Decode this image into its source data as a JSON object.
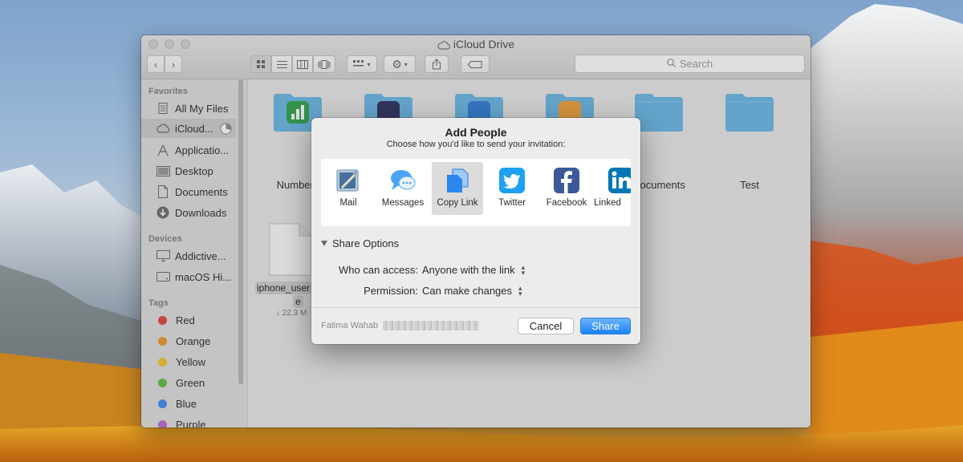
{
  "window": {
    "title": "iCloud Drive",
    "search_placeholder": "Search"
  },
  "sidebar": {
    "favorites_header": "Favorites",
    "favorites": [
      {
        "label": "All My Files",
        "icon": "all-files-icon"
      },
      {
        "label": "iCloud...",
        "icon": "cloud-icon",
        "selected": true
      },
      {
        "label": "Applicatio...",
        "icon": "applications-icon"
      },
      {
        "label": "Desktop",
        "icon": "desktop-icon"
      },
      {
        "label": "Documents",
        "icon": "documents-icon"
      },
      {
        "label": "Downloads",
        "icon": "downloads-icon"
      }
    ],
    "devices_header": "Devices",
    "devices": [
      {
        "label": "Addictive...",
        "icon": "monitor-icon"
      },
      {
        "label": "macOS Hi...",
        "icon": "disk-icon"
      }
    ],
    "tags_header": "Tags",
    "tags": [
      {
        "label": "Red",
        "color": "#e0443e"
      },
      {
        "label": "Orange",
        "color": "#f0952a"
      },
      {
        "label": "Yellow",
        "color": "#efc627"
      },
      {
        "label": "Green",
        "color": "#5fc040"
      },
      {
        "label": "Blue",
        "color": "#3f8ef2"
      },
      {
        "label": "Purple",
        "color": "#b56ad8"
      }
    ]
  },
  "content": {
    "folders": [
      {
        "label": "Numbers"
      },
      {
        "label": "Documents"
      },
      {
        "label": "Test"
      }
    ],
    "file": {
      "name_line1": "iphone_user",
      "name_line2": "e",
      "size": "↓ 22.3 M"
    }
  },
  "sheet": {
    "title": "Add People",
    "subtitle": "Choose how you'd like to send your invitation:",
    "services": [
      {
        "label": "Mail",
        "icon": "mail-icon"
      },
      {
        "label": "Messages",
        "icon": "messages-icon"
      },
      {
        "label": "Copy Link",
        "icon": "copy-link-icon",
        "selected": true
      },
      {
        "label": "Twitter",
        "icon": "twitter-icon"
      },
      {
        "label": "Facebook",
        "icon": "facebook-icon"
      },
      {
        "label": "Linked",
        "icon": "linkedin-icon"
      }
    ],
    "share_options_label": "Share Options",
    "access_label": "Who can access:",
    "access_value": "Anyone with the link",
    "permission_label": "Permission:",
    "permission_value": "Can make changes",
    "owner_name": "Fatima Wahab",
    "cancel_label": "Cancel",
    "share_label": "Share"
  },
  "colors": {
    "accent": "#1a82fb",
    "twitter": "#1da1f2",
    "facebook": "#3b5998",
    "linkedin": "#0077b5"
  }
}
